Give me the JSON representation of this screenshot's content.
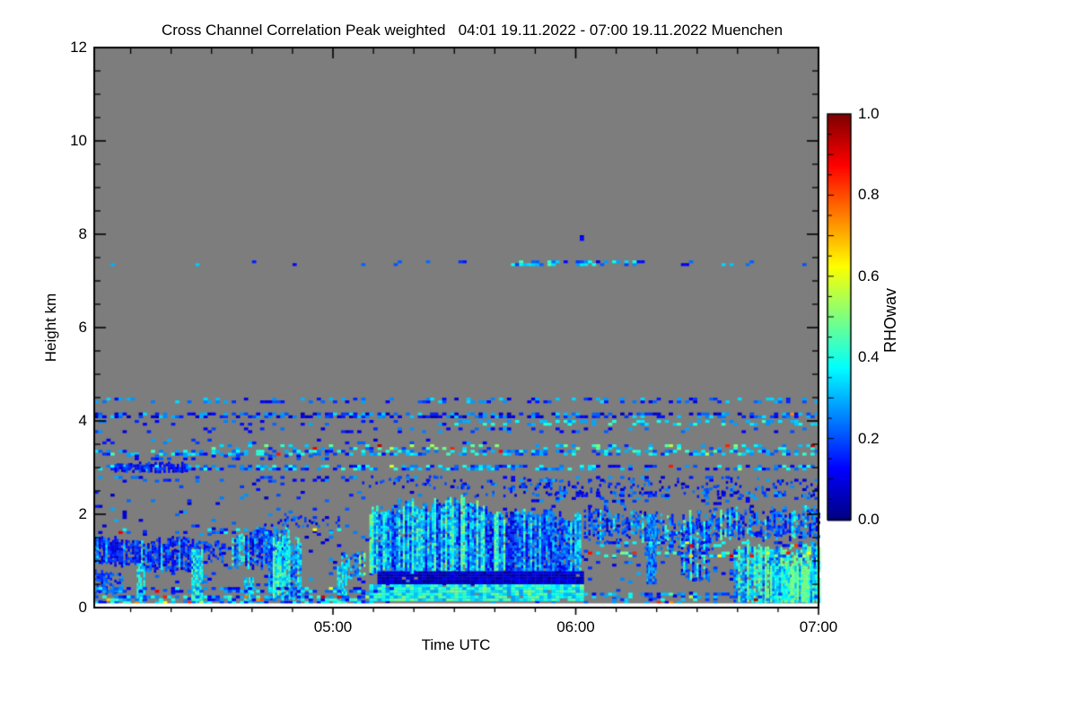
{
  "title": "Cross Channel Correlation Peak weighted   04:01 19.11.2022 - 07:00 19.11.2022 Muenchen",
  "chart_data": {
    "type": "heatmap",
    "title": "Cross Channel Correlation Peak weighted",
    "time_range_label": "04:01 19.11.2022 - 07:00 19.11.2022",
    "station": "Muenchen",
    "xlabel": "Time UTC",
    "ylabel": "Height km",
    "x_range_minutes": [
      241,
      420
    ],
    "x_major_ticks": [
      {
        "minute": 300,
        "label": "05:00"
      },
      {
        "minute": 360,
        "label": "06:00"
      },
      {
        "minute": 420,
        "label": "07:00"
      }
    ],
    "x_minor_step_minutes": 10,
    "y_range_km": [
      0,
      12
    ],
    "y_major_ticks": [
      {
        "km": 0,
        "label": "0"
      },
      {
        "km": 2,
        "label": "2"
      },
      {
        "km": 4,
        "label": "4"
      },
      {
        "km": 6,
        "label": "6"
      },
      {
        "km": 8,
        "label": "8"
      },
      {
        "km": 10,
        "label": "10"
      },
      {
        "km": 12,
        "label": "12"
      }
    ],
    "y_minor_step_km": 0.5,
    "grid": false,
    "background_value_color": "#7d7d7d",
    "no_data_color": "#ffffff",
    "missing_bottom_km": 0.09,
    "colorbar": {
      "label": "RHOwav",
      "range": [
        0,
        1
      ],
      "tick_values": [
        0.0,
        0.2,
        0.4,
        0.6,
        0.8,
        1.0
      ],
      "tick_labels": [
        "0.0",
        "0.2",
        "0.4",
        "0.6",
        "0.8",
        "1.0"
      ],
      "colormap": "jet",
      "stops": [
        [
          0.0,
          "#000080"
        ],
        [
          0.125,
          "#0000ff"
        ],
        [
          0.25,
          "#0080ff"
        ],
        [
          0.375,
          "#00ffff"
        ],
        [
          0.5,
          "#80ff80"
        ],
        [
          0.625,
          "#ffff00"
        ],
        [
          0.75,
          "#ff8000"
        ],
        [
          0.875,
          "#ff0000"
        ],
        [
          1.0,
          "#800000"
        ]
      ]
    },
    "regions": [
      {
        "kind": "row",
        "t": [
          241,
          420
        ],
        "h": [
          2.2,
          2.7
        ],
        "d": 0.04,
        "v": [
          0.05,
          0.3
        ]
      },
      {
        "kind": "row",
        "t": [
          241,
          420
        ],
        "h": [
          0.1,
          2.2
        ],
        "d": 0.055,
        "v": [
          0.05,
          0.3
        ]
      },
      {
        "kind": "cloud",
        "t": [
          330,
          420
        ],
        "h": [
          2.35,
          2.9
        ],
        "d": 0.18,
        "v": [
          0.04,
          0.3
        ],
        "jt": 0.35,
        "jb": 0.05
      },
      {
        "kind": "cloud",
        "t": [
          305,
          335
        ],
        "h": [
          2.5,
          2.95
        ],
        "d": 0.15,
        "v": [
          0.05,
          0.3
        ],
        "jt": 0.3,
        "jb": 0.1
      },
      {
        "kind": "row",
        "t": [
          245,
          420
        ],
        "h": [
          7.32,
          7.42
        ],
        "d": 0.08,
        "v": [
          0.1,
          0.35
        ]
      },
      {
        "kind": "row",
        "t": [
          344,
          357
        ],
        "h": [
          7.32,
          7.42
        ],
        "d": 0.45,
        "v": [
          0.15,
          0.45
        ]
      },
      {
        "kind": "row",
        "t": [
          360,
          377
        ],
        "h": [
          7.32,
          7.42
        ],
        "d": 0.4,
        "v": [
          0.1,
          0.4
        ]
      },
      {
        "kind": "row",
        "t": [
          361,
          362
        ],
        "h": [
          7.86,
          7.96
        ],
        "d": 0.9,
        "v": [
          0.05,
          0.15
        ]
      },
      {
        "kind": "row",
        "t": [
          241,
          420
        ],
        "h": [
          4.38,
          4.46
        ],
        "d": 0.3,
        "v": [
          0.08,
          0.35
        ]
      },
      {
        "kind": "row",
        "t": [
          241,
          420
        ],
        "h": [
          4.06,
          4.16
        ],
        "d": 0.55,
        "v": [
          0.05,
          0.35
        ],
        "warm": 0.01
      },
      {
        "kind": "row",
        "t": [
          330,
          420
        ],
        "h": [
          3.9,
          3.98
        ],
        "d": 0.3,
        "v": [
          0.25,
          0.45
        ]
      },
      {
        "kind": "row",
        "t": [
          241,
          330
        ],
        "h": [
          3.9,
          3.98
        ],
        "d": 0.1,
        "v": [
          0.1,
          0.3
        ]
      },
      {
        "kind": "row",
        "t": [
          241,
          420
        ],
        "h": [
          3.74,
          3.82
        ],
        "d": 0.15,
        "v": [
          0.08,
          0.3
        ]
      },
      {
        "kind": "row",
        "t": [
          241,
          340
        ],
        "h": [
          3.5,
          3.58
        ],
        "d": 0.08,
        "v": [
          0.08,
          0.3
        ]
      },
      {
        "kind": "row",
        "t": [
          270,
          345
        ],
        "h": [
          3.38,
          3.46
        ],
        "d": 0.22,
        "v": [
          0.15,
          0.55
        ],
        "warm": 0.08
      },
      {
        "kind": "row",
        "t": [
          350,
          420
        ],
        "h": [
          3.38,
          3.46
        ],
        "d": 0.26,
        "v": [
          0.15,
          0.5
        ],
        "warm": 0.1
      },
      {
        "kind": "row",
        "t": [
          241,
          420
        ],
        "h": [
          3.26,
          3.36
        ],
        "d": 0.5,
        "v": [
          0.12,
          0.45
        ],
        "warm": 0.02
      },
      {
        "kind": "row",
        "t": [
          241,
          300
        ],
        "h": [
          3.16,
          3.24
        ],
        "d": 0.25,
        "v": [
          0.08,
          0.3
        ]
      },
      {
        "kind": "row",
        "t": [
          241,
          420
        ],
        "h": [
          2.94,
          3.04
        ],
        "d": 0.45,
        "v": [
          0.1,
          0.42
        ],
        "warm": 0.03
      },
      {
        "kind": "cloud",
        "t": [
          246,
          264
        ],
        "h": [
          2.88,
          3.12
        ],
        "d": 0.75,
        "v": [
          0.03,
          0.25
        ],
        "jt": 0.08,
        "jb": 0.04
      },
      {
        "kind": "row",
        "t": [
          241,
          420
        ],
        "h": [
          2.7,
          2.8
        ],
        "d": 0.15,
        "v": [
          0.08,
          0.3
        ]
      },
      {
        "kind": "cloud",
        "t": [
          241,
          253
        ],
        "h": [
          0.85,
          1.8
        ],
        "d": 0.85,
        "v": [
          0.02,
          0.28
        ],
        "jt": 0.5,
        "jb": 0.15,
        "cyan": 0.15
      },
      {
        "kind": "cloud",
        "t": [
          241,
          248
        ],
        "h": [
          0.25,
          0.85
        ],
        "d": 0.6,
        "v": [
          0.05,
          0.3
        ],
        "jt": 0.2,
        "jb": 0.1
      },
      {
        "kind": "cloud",
        "t": [
          253,
          267
        ],
        "h": [
          0.75,
          1.65
        ],
        "d": 0.82,
        "v": [
          0.02,
          0.3
        ],
        "jt": 0.45,
        "jb": 0.1,
        "cyan": 0.2
      },
      {
        "kind": "cloud",
        "t": [
          268,
          274
        ],
        "h": [
          0.95,
          1.5
        ],
        "d": 0.5,
        "v": [
          0.05,
          0.3
        ],
        "jt": 0.3,
        "jb": 0.1
      },
      {
        "kind": "cloud",
        "t": [
          275,
          289
        ],
        "h": [
          0.8,
          1.95
        ],
        "d": 0.78,
        "v": [
          0.03,
          0.35
        ],
        "jt": 0.5,
        "jb": 0.15,
        "cyan": 0.25
      },
      {
        "kind": "cloud",
        "t": [
          284,
          292
        ],
        "h": [
          0.15,
          1.7
        ],
        "d": 0.85,
        "v": [
          0.1,
          0.45
        ],
        "jt": 0.4,
        "jb": 0.05,
        "cyan": 0.5
      },
      {
        "kind": "cloud",
        "t": [
          283,
          302
        ],
        "h": [
          1.7,
          2.1
        ],
        "d": 0.25,
        "v": [
          0.05,
          0.3
        ],
        "jt": 0.3,
        "jb": 0.05
      },
      {
        "kind": "cloud",
        "t": [
          302,
          308
        ],
        "h": [
          0.6,
          1.25
        ],
        "d": 0.55,
        "v": [
          0.1,
          0.4
        ],
        "jt": 0.2,
        "jb": 0.1,
        "cyan": 0.3
      },
      {
        "kind": "cloud",
        "t": [
          309,
          341
        ],
        "h": [
          0.72,
          2.55
        ],
        "d": 0.95,
        "v": [
          0.04,
          0.42
        ],
        "jt": 0.65,
        "jb": 0.03,
        "cyan": 0.35
      },
      {
        "kind": "cloud",
        "t": [
          341,
          361
        ],
        "h": [
          0.72,
          2.25
        ],
        "d": 0.92,
        "v": [
          0.04,
          0.4
        ],
        "jt": 0.45,
        "jb": 0.03,
        "cyan": 0.3
      },
      {
        "kind": "row",
        "t": [
          311,
          362
        ],
        "h": [
          0.48,
          0.74
        ],
        "d": 0.97,
        "v": [
          0.02,
          0.12
        ]
      },
      {
        "kind": "row",
        "t": [
          309,
          362
        ],
        "h": [
          0.14,
          0.48
        ],
        "d": 0.97,
        "v": [
          0.28,
          0.5
        ]
      },
      {
        "kind": "cloud",
        "t": [
          362,
          377
        ],
        "h": [
          1.35,
          2.3
        ],
        "d": 0.55,
        "v": [
          0.04,
          0.35
        ],
        "jt": 0.5,
        "jb": 0.3,
        "cyan": 0.2
      },
      {
        "kind": "cloud",
        "t": [
          377,
          394
        ],
        "h": [
          1.15,
          2.25
        ],
        "d": 0.5,
        "v": [
          0.04,
          0.35
        ],
        "jt": 0.5,
        "jb": 0.25,
        "cyan": 0.15
      },
      {
        "kind": "cloud",
        "t": [
          394,
          420
        ],
        "h": [
          1.4,
          2.3
        ],
        "d": 0.65,
        "v": [
          0.04,
          0.38
        ],
        "jt": 0.4,
        "jb": 0.2,
        "cyan": 0.25
      },
      {
        "kind": "cloud",
        "t": [
          386,
          393
        ],
        "h": [
          0.55,
          1.9
        ],
        "d": 0.65,
        "v": [
          0.05,
          0.35
        ],
        "jt": 0.15,
        "jb": 0.05,
        "cyan": 0.2
      },
      {
        "kind": "cloud",
        "t": [
          399,
          420
        ],
        "h": [
          0.1,
          1.45
        ],
        "d": 0.88,
        "v": [
          0.12,
          0.48
        ],
        "jt": 0.3,
        "jb": 0.02,
        "cyan": 0.5
      },
      {
        "kind": "cloud",
        "t": [
          408,
          420
        ],
        "h": [
          0.1,
          0.9
        ],
        "d": 0.95,
        "v": [
          0.2,
          0.5
        ],
        "jt": 0.1,
        "jb": 0.02,
        "cyan": 0.4
      },
      {
        "kind": "streak",
        "t": [
          251.5,
          253.5
        ],
        "h": [
          0.05,
          0.95
        ],
        "d": 0.85,
        "v": [
          0.25,
          0.45
        ]
      },
      {
        "kind": "streak",
        "t": [
          265,
          267.5
        ],
        "h": [
          0.05,
          1.25
        ],
        "d": 0.85,
        "v": [
          0.28,
          0.48
        ]
      },
      {
        "kind": "streak",
        "t": [
          278,
          280
        ],
        "h": [
          0.05,
          0.6
        ],
        "d": 0.8,
        "v": [
          0.25,
          0.45
        ]
      },
      {
        "kind": "streak",
        "t": [
          301,
          303
        ],
        "h": [
          0.05,
          0.85
        ],
        "d": 0.8,
        "v": [
          0.25,
          0.45
        ]
      },
      {
        "kind": "streak",
        "t": [
          377.5,
          379.5
        ],
        "h": [
          0.5,
          1.95
        ],
        "d": 0.8,
        "v": [
          0.15,
          0.35
        ]
      },
      {
        "kind": "row",
        "t": [
          241,
          310
        ],
        "h": [
          1.58,
          1.68
        ],
        "d": 0.2,
        "v": [
          0.1,
          0.4
        ],
        "warm": 0.12
      },
      {
        "kind": "row",
        "t": [
          362,
          420
        ],
        "h": [
          1.08,
          1.18
        ],
        "d": 0.4,
        "v": [
          0.1,
          0.5
        ],
        "warm": 0.25
      },
      {
        "kind": "row",
        "t": [
          365,
          420
        ],
        "h": [
          1.3,
          1.38
        ],
        "d": 0.25,
        "v": [
          0.1,
          0.45
        ],
        "warm": 0.1
      },
      {
        "kind": "row",
        "t": [
          355,
          420
        ],
        "h": [
          2.25,
          2.45
        ],
        "d": 0.12,
        "v": [
          0.05,
          0.3
        ]
      },
      {
        "kind": "row",
        "t": [
          241,
          315
        ],
        "h": [
          0.32,
          0.42
        ],
        "d": 0.5,
        "v": [
          0.08,
          0.4
        ],
        "warm": 0.03
      },
      {
        "kind": "row",
        "t": [
          241,
          310
        ],
        "h": [
          0.08,
          0.26
        ],
        "d": 0.55,
        "v": [
          0.1,
          0.45
        ],
        "warm": 0.06
      },
      {
        "kind": "row",
        "t": [
          362,
          420
        ],
        "h": [
          0.2,
          0.3
        ],
        "d": 0.45,
        "v": [
          0.1,
          0.45
        ],
        "warm": 0.1
      },
      {
        "kind": "row",
        "t": [
          362,
          408
        ],
        "h": [
          0.08,
          0.18
        ],
        "d": 0.2,
        "v": [
          0.1,
          0.45
        ],
        "warm": 0.15
      }
    ]
  }
}
